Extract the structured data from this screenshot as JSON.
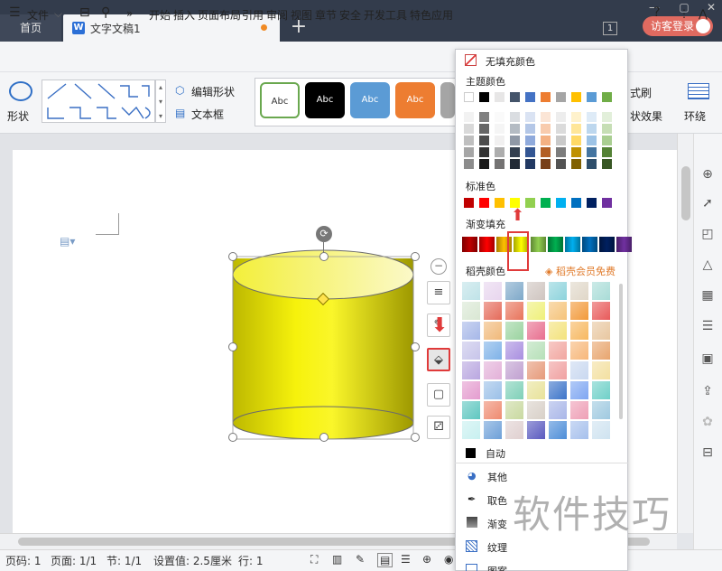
{
  "tabs": {
    "home": "首页",
    "doc_title": "文字文稿1",
    "doc_icon": "W",
    "new_tab": "+"
  },
  "window": {
    "notif_count": "1",
    "visitor": "访客登录",
    "min": "—",
    "max": "▢",
    "close": "✕"
  },
  "menu": {
    "file": "文件",
    "items": [
      "开始",
      "插入",
      "页面布局",
      "引用",
      "审阅",
      "视图",
      "章节",
      "安全",
      "开发工具",
      "特色应用"
    ],
    "more": "»",
    "help": "?",
    "collapse": "⋀"
  },
  "ribbon": {
    "shape": "形状",
    "edit_shape": "编辑形状",
    "text_box": "文本框",
    "style_label": "Abc",
    "format_brush": "式刷",
    "shape_effect": "状效果",
    "wrap": "环绕"
  },
  "popup": {
    "no_fill": "无填充颜色",
    "theme_colors": "主题颜色",
    "standard_colors": "标准色",
    "gradient_fill": "渐变填充",
    "daoke_colors": "稻壳颜色",
    "member_free": "稻壳会员免费",
    "auto": "自动",
    "other": "其他",
    "eyedropper": "取色",
    "gradient": "渐变",
    "texture": "纹理",
    "picture": "图案"
  },
  "colors": {
    "theme_row": [
      "#ffffff",
      "#000000",
      "#e7e6e6",
      "#44546a",
      "#4472c4",
      "#ed7d31",
      "#a5a5a5",
      "#ffc000",
      "#5b9bd5",
      "#70ad47"
    ],
    "standard": [
      "#c00000",
      "#ff0000",
      "#ffc000",
      "#ffff00",
      "#92d050",
      "#00b050",
      "#00b0f0",
      "#0070c0",
      "#002060",
      "#7030a0"
    ],
    "accent_red": "#e03a3a",
    "shape_fill": "#f5f20a"
  },
  "statusbar": {
    "page_code": "页码: 1",
    "pages": "页面: 1/1",
    "section": "节: 1/1",
    "setting": "设置值: 2.5厘米",
    "row": "行: 1"
  },
  "watermark": "软件技巧"
}
